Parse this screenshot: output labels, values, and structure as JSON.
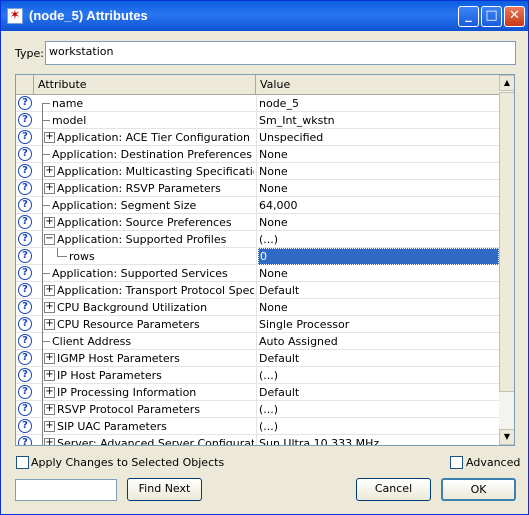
{
  "window": {
    "title": "(node_5) Attributes"
  },
  "type_field": {
    "label": "Type:",
    "value": "workstation"
  },
  "grid": {
    "header": {
      "attribute": "Attribute",
      "value": "Value"
    },
    "rows": [
      {
        "attr": "name",
        "value": "node_5",
        "expander": "",
        "level": 0,
        "connector": "top"
      },
      {
        "attr": "model",
        "value": "Sm_Int_wkstn",
        "expander": "",
        "level": 0,
        "connector": "mid"
      },
      {
        "attr": "Application: ACE Tier Configuration",
        "value": "Unspecified",
        "expander": "+",
        "level": 0,
        "connector": "mid"
      },
      {
        "attr": "Application: Destination Preferences",
        "value": "None",
        "expander": "",
        "level": 0,
        "connector": "mid"
      },
      {
        "attr": "Application: Multicasting Specification",
        "value": "None",
        "expander": "+",
        "level": 0,
        "connector": "mid"
      },
      {
        "attr": "Application: RSVP Parameters",
        "value": "None",
        "expander": "+",
        "level": 0,
        "connector": "mid"
      },
      {
        "attr": "Application: Segment Size",
        "value": "64,000",
        "expander": "",
        "level": 0,
        "connector": "mid"
      },
      {
        "attr": "Application: Source Preferences",
        "value": "None",
        "expander": "+",
        "level": 0,
        "connector": "mid"
      },
      {
        "attr": "Application: Supported Profiles",
        "value": "(...)",
        "expander": "-",
        "level": 0,
        "connector": "mid"
      },
      {
        "attr": "rows",
        "value": "0",
        "expander": "",
        "level": 1,
        "connector": "last",
        "selected": true
      },
      {
        "attr": "Application: Supported Services",
        "value": "None",
        "expander": "",
        "level": 0,
        "connector": "mid"
      },
      {
        "attr": "Application: Transport Protocol Specifica...",
        "value": "Default",
        "expander": "+",
        "level": 0,
        "connector": "mid"
      },
      {
        "attr": "CPU Background Utilization",
        "value": "None",
        "expander": "+",
        "level": 0,
        "connector": "mid"
      },
      {
        "attr": "CPU Resource Parameters",
        "value": "Single Processor",
        "expander": "+",
        "level": 0,
        "connector": "mid"
      },
      {
        "attr": "Client Address",
        "value": "Auto Assigned",
        "expander": "",
        "level": 0,
        "connector": "mid"
      },
      {
        "attr": "IGMP Host Parameters",
        "value": "Default",
        "expander": "+",
        "level": 0,
        "connector": "mid"
      },
      {
        "attr": "IP Host Parameters",
        "value": "(...)",
        "expander": "+",
        "level": 0,
        "connector": "mid"
      },
      {
        "attr": "IP Processing Information",
        "value": "Default",
        "expander": "+",
        "level": 0,
        "connector": "mid"
      },
      {
        "attr": "RSVP Protocol Parameters",
        "value": "(...)",
        "expander": "+",
        "level": 0,
        "connector": "mid"
      },
      {
        "attr": "SIP UAC Parameters",
        "value": "(...)",
        "expander": "+",
        "level": 0,
        "connector": "mid"
      },
      {
        "attr": "Server: Advanced Server Configuration",
        "value": "Sun Ultra 10 333 MHz",
        "expander": "+",
        "level": 0,
        "connector": "mid"
      }
    ]
  },
  "footer": {
    "apply_label": "Apply Changes to Selected Objects",
    "advanced_label": "Advanced",
    "find_input_value": "",
    "find_next_label": "Find Next",
    "cancel_label": "Cancel",
    "ok_label": "OK"
  },
  "colors": {
    "title_bar": "#0a5fe0",
    "selection": "#316ac5",
    "help_icon": "#1a46b8"
  }
}
